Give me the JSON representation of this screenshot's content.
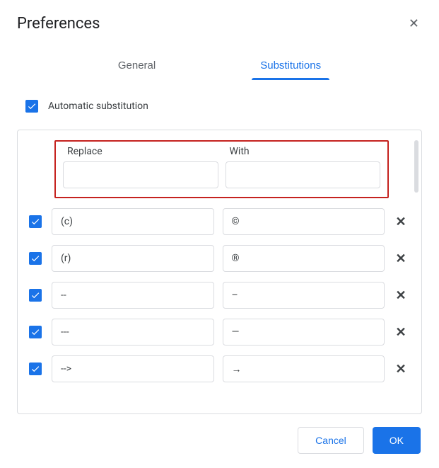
{
  "title": "Preferences",
  "tabs": {
    "general": "General",
    "substitutions": "Substitutions",
    "active": "substitutions"
  },
  "auto_substitution": {
    "label": "Automatic substitution",
    "checked": true
  },
  "columns": {
    "replace": "Replace",
    "with": "With"
  },
  "new_row": {
    "replace": "",
    "with": ""
  },
  "rows": [
    {
      "enabled": true,
      "replace": "(c)",
      "with": "©"
    },
    {
      "enabled": true,
      "replace": "(r)",
      "with": "®"
    },
    {
      "enabled": true,
      "replace": "--",
      "with": "–"
    },
    {
      "enabled": true,
      "replace": "---",
      "with": "—"
    },
    {
      "enabled": true,
      "replace": "-->",
      "with": "→"
    }
  ],
  "buttons": {
    "cancel": "Cancel",
    "ok": "OK"
  },
  "icons": {
    "close": "✕",
    "delete": "✕"
  }
}
